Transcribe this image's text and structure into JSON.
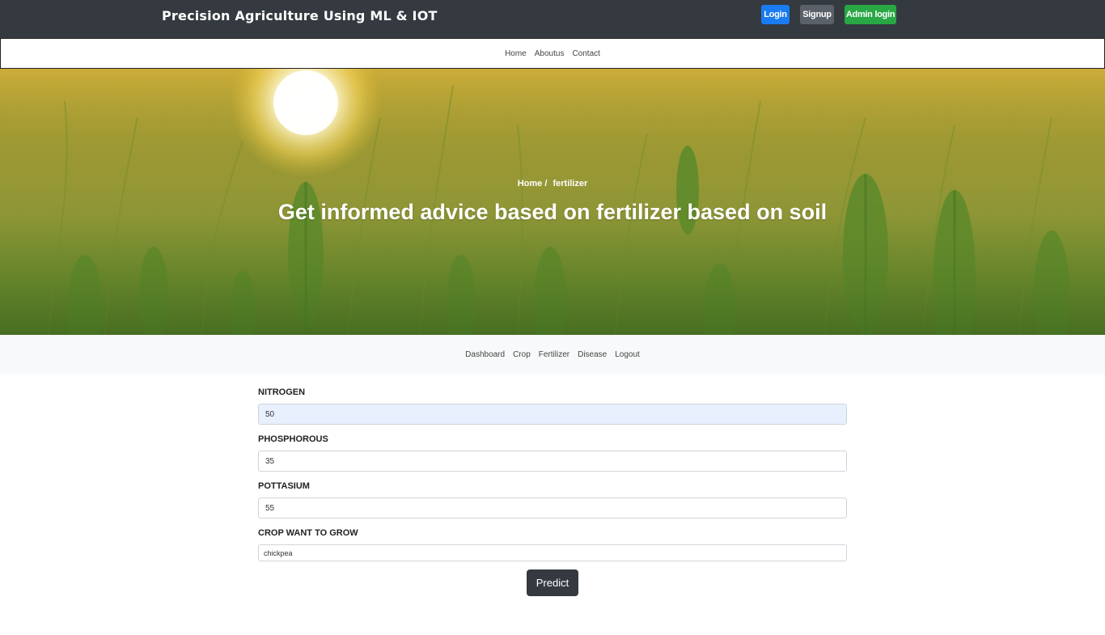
{
  "header": {
    "brand": "Precision Agriculture Using ML & IOT",
    "buttons": {
      "login": "Login",
      "signup": "Signup",
      "admin_login": "Admin login"
    }
  },
  "main_nav": {
    "items": [
      "Home",
      "Aboutus",
      "Contact"
    ]
  },
  "hero": {
    "breadcrumb": {
      "home": "Home /",
      "current": "fertilizer"
    },
    "title": "Get informed advice based on fertilizer based on soil"
  },
  "sub_nav": {
    "items": [
      "Dashboard",
      "Crop",
      "Fertilizer",
      "Disease",
      "Logout"
    ]
  },
  "form": {
    "nitrogen": {
      "label": "NITROGEN",
      "value": "50"
    },
    "phosphorous": {
      "label": "PHOSPHOROUS",
      "value": "35"
    },
    "pottasium": {
      "label": "POTTASIUM",
      "value": "55"
    },
    "crop": {
      "label": "CROP WANT TO GROW",
      "value": "chickpea"
    },
    "submit_label": "Predict"
  },
  "colors": {
    "topbar": "#343a40",
    "login_button": "#1a7bf2",
    "signup_button": "#5a6168",
    "admin_button": "#28a745",
    "subnav_bg": "#f8f9fa",
    "autofill_bg": "#e8f0fe"
  }
}
